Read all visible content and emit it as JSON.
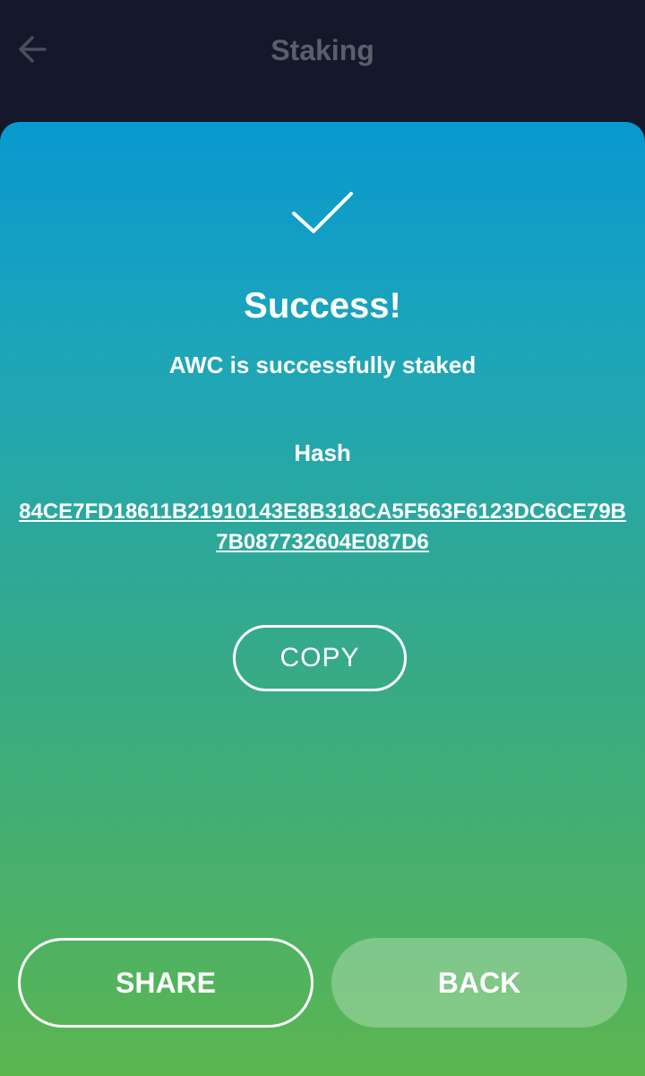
{
  "header": {
    "title": "Staking",
    "back_icon": "arrow-left-icon"
  },
  "result": {
    "icon": "checkmark-icon",
    "title": "Success!",
    "subtitle": "AWC is successfully staked",
    "hash_label": "Hash",
    "hash_value": "84CE7FD18611B21910143E8B318CA5F563F6123DC6CE79B7B087732604E087D6",
    "copy_label": "COPY"
  },
  "actions": {
    "share_label": "SHARE",
    "back_label": "BACK"
  },
  "colors": {
    "header_bg": "#14182a",
    "header_title": "#5c5f6b",
    "gradient_top": "#0899cf",
    "gradient_bottom": "#5bb650",
    "text": "#ffffff"
  }
}
